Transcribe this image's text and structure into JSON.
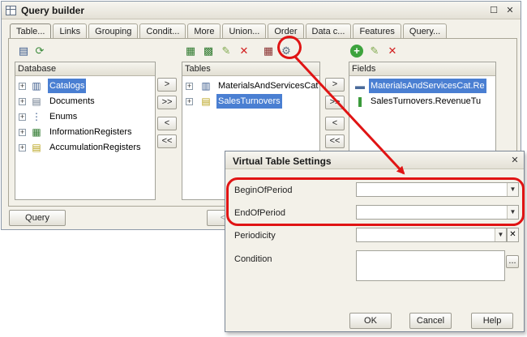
{
  "query_builder": {
    "title": "Query builder",
    "tabs": [
      "Table...",
      "Links",
      "Grouping",
      "Condit...",
      "More",
      "Union...",
      "Order",
      "Data c...",
      "Features",
      "Query..."
    ],
    "database_panel": {
      "header": "Database",
      "items": [
        {
          "label": "Catalogs",
          "icon": "catalog-icon",
          "selected": true
        },
        {
          "label": "Documents",
          "icon": "document-icon",
          "selected": false
        },
        {
          "label": "Enums",
          "icon": "enum-icon",
          "selected": false
        },
        {
          "label": "InformationRegisters",
          "icon": "information-register-icon",
          "selected": false
        },
        {
          "label": "AccumulationRegisters",
          "icon": "accumulation-register-icon",
          "selected": false
        }
      ]
    },
    "tables_panel": {
      "header": "Tables",
      "items": [
        {
          "label": "MaterialsAndServicesCat",
          "icon": "catalog-icon",
          "selected": false
        },
        {
          "label": "SalesTurnovers",
          "icon": "accumulation-register-icon",
          "selected": true
        }
      ]
    },
    "fields_panel": {
      "header": "Fields",
      "items": [
        {
          "label": "MaterialsAndServicesCat.Re",
          "icon": "dimension-icon",
          "selected": true
        },
        {
          "label": "SalesTurnovers.RevenueTu",
          "icon": "resource-icon",
          "selected": false
        }
      ]
    },
    "move_buttons": [
      ">",
      ">>",
      "<",
      "<<"
    ],
    "query_button": "Query",
    "partial_button": "<"
  },
  "virtual_table_settings": {
    "title": "Virtual Table Settings",
    "fields": [
      {
        "label": "BeginOfPeriod",
        "value": ""
      },
      {
        "label": "EndOfPeriod",
        "value": ""
      },
      {
        "label": "Periodicity",
        "value": ""
      },
      {
        "label": "Condition",
        "value": ""
      }
    ],
    "ok_label": "OK",
    "cancel_label": "Cancel",
    "help_label": "Help",
    "condition_ellipsis": "..."
  },
  "colors": {
    "selection": "#4a7fd2",
    "annotation": "#e01414",
    "window_bg": "#f3f1e9"
  }
}
